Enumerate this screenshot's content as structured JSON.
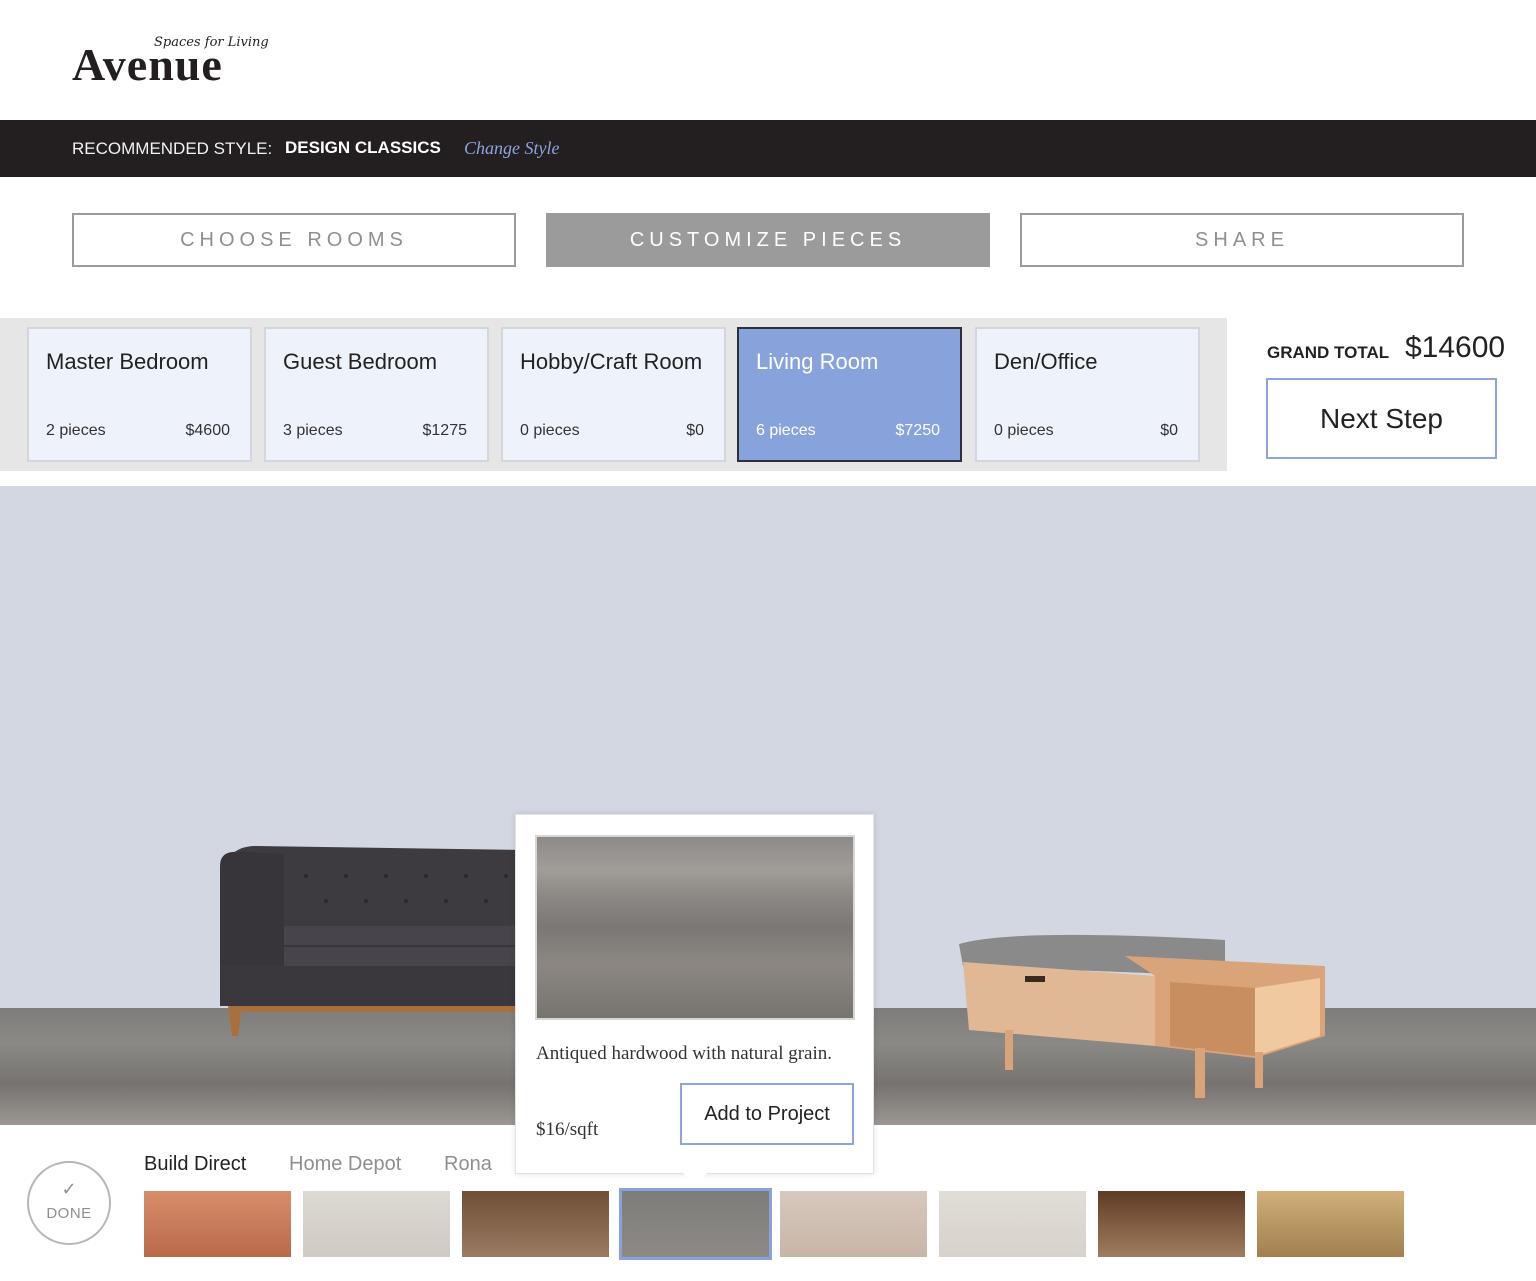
{
  "logo": {
    "tagline": "Spaces for Living",
    "name": "Avenue"
  },
  "style_bar": {
    "label": "RECOMMENDED STYLE:",
    "value": "DESIGN CLASSICS",
    "change_link": "Change Style"
  },
  "steps": [
    {
      "label": "CHOOSE ROOMS",
      "active": false
    },
    {
      "label": "CUSTOMIZE PIECES",
      "active": true
    },
    {
      "label": "SHARE",
      "active": false
    }
  ],
  "rooms": [
    {
      "name": "Master Bedroom",
      "pieces": "2 pieces",
      "price": "$4600",
      "active": false
    },
    {
      "name": "Guest Bedroom",
      "pieces": "3 pieces",
      "price": "$1275",
      "active": false
    },
    {
      "name": "Hobby/Craft Room",
      "pieces": "0 pieces",
      "price": "$0",
      "active": false
    },
    {
      "name": "Living Room",
      "pieces": "6 pieces",
      "price": "$7250",
      "active": true
    },
    {
      "name": "Den/Office",
      "pieces": "0 pieces",
      "price": "$0",
      "active": false
    }
  ],
  "grand_total": {
    "label": "GRAND TOTAL",
    "value": "$14600"
  },
  "next_step_label": "Next Step",
  "popup": {
    "description": "Antiqued hardwood with natural grain.",
    "price": "$16/sqft",
    "add_button": "Add to Project"
  },
  "done_label": "DONE",
  "vendors": [
    {
      "label": "Build Direct",
      "active": true
    },
    {
      "label": "Home Depot",
      "active": false
    },
    {
      "label": "Rona",
      "active": false
    }
  ],
  "swatches": [
    {
      "name": "swatch-warm-maple",
      "color_top": "#d98e6b",
      "color_bottom": "#b86a4a",
      "selected": false
    },
    {
      "name": "swatch-light-gray",
      "color_top": "#ddd9d3",
      "color_bottom": "#cfcac3",
      "selected": false
    },
    {
      "name": "swatch-brown-oak",
      "color_top": "#6f4f36",
      "color_bottom": "#9a7b63",
      "selected": false
    },
    {
      "name": "swatch-antiqued-gray",
      "color_top": "#7e7c79",
      "color_bottom": "#8d8a86",
      "selected": true
    },
    {
      "name": "swatch-pale-stone",
      "color_top": "#d7c8bd",
      "color_bottom": "#c8b5a7",
      "selected": false
    },
    {
      "name": "swatch-off-white",
      "color_top": "#e1ddd7",
      "color_bottom": "#d7d2cb",
      "selected": false
    },
    {
      "name": "swatch-dark-walnut",
      "color_top": "#5e3b24",
      "color_bottom": "#a07d60",
      "selected": false
    },
    {
      "name": "swatch-rustic-plank",
      "color_top": "#d2b07a",
      "color_bottom": "#a17f4f",
      "selected": false
    }
  ],
  "colors": {
    "accent": "#88a2dc",
    "accent_border": "#8ea3e0",
    "dark_bar": "#231f20",
    "scene_wall": "#d3d7e2"
  }
}
